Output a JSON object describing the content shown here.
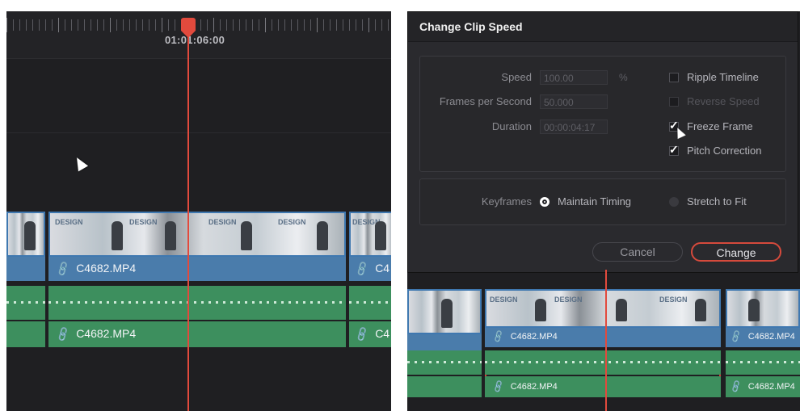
{
  "left": {
    "timecode": "01:01:06:00",
    "video_clip_label": "C4682.MP4",
    "video_clip_label_next": "C4",
    "audio_clip_label": "C4682.MP4",
    "audio_clip_label_next": "C4"
  },
  "dialog": {
    "title": "Change Clip Speed",
    "speed_label": "Speed",
    "speed_value": "100.00",
    "speed_unit": "%",
    "fps_label": "Frames per Second",
    "fps_value": "50.000",
    "duration_label": "Duration",
    "duration_value": "00:00:04:17",
    "ripple_label": "Ripple Timeline",
    "reverse_label": "Reverse Speed",
    "freeze_label": "Freeze Frame",
    "pitch_label": "Pitch Correction",
    "keyframes_label": "Keyframes",
    "maintain_label": "Maintain Timing",
    "stretch_label": "Stretch to Fit",
    "cancel_label": "Cancel",
    "change_label": "Change",
    "checkbox_state": {
      "ripple": false,
      "reverse": false,
      "freeze": true,
      "pitch": true
    },
    "keyframes_selected": "Maintain Timing"
  },
  "right": {
    "video_clip_label": "C4682.MP4",
    "video_clip_label_next": "C4682.MP4",
    "audio_clip_label": "C4682.MP4",
    "audio_clip_label_next": "C4682.MP4"
  },
  "colors": {
    "playhead": "#e24a3d",
    "video": "#4a7cab",
    "audio": "#3d8f5e",
    "selection": "#d63a34"
  }
}
